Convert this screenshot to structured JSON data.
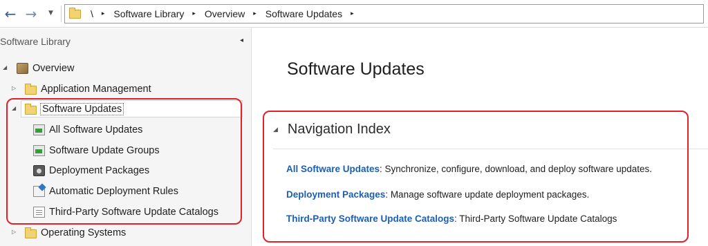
{
  "toolbar": {
    "back_icon": "←",
    "forward_icon": "→",
    "dropdown_icon": "▼"
  },
  "address": {
    "root": "\\",
    "crumbs": [
      "Software Library",
      "Overview",
      "Software Updates"
    ],
    "separator": "▸"
  },
  "sidebar": {
    "title": "Software Library",
    "collapse_icon": "◂",
    "overview": "Overview",
    "items": [
      {
        "label": "Application Management",
        "icon": "folder-icon"
      },
      {
        "label": "Software Updates",
        "icon": "folder-icon",
        "selected": true
      },
      {
        "label": "All Software Updates",
        "icon": "software-update-icon"
      },
      {
        "label": "Software Update Groups",
        "icon": "software-update-group-icon"
      },
      {
        "label": "Deployment Packages",
        "icon": "deployment-package-icon"
      },
      {
        "label": "Automatic Deployment Rules",
        "icon": "deployment-rule-icon"
      },
      {
        "label": "Third-Party Software Update Catalogs",
        "icon": "catalog-icon"
      },
      {
        "label": "Operating Systems",
        "icon": "folder-icon"
      }
    ]
  },
  "main": {
    "title": "Software Updates",
    "section_title": "Navigation Index",
    "nav_index": [
      {
        "link": "All Software Updates",
        "desc": ": Synchronize, configure, download, and deploy software updates."
      },
      {
        "link": "Deployment Packages",
        "desc": ": Manage software update deployment packages."
      },
      {
        "link": "Third-Party Software Update Catalogs",
        "desc": ": Third-Party Software Update Catalogs"
      }
    ]
  },
  "colors": {
    "link": "#1a5fb4",
    "highlight_border": "#e0212a",
    "folder": "#f2d374"
  }
}
